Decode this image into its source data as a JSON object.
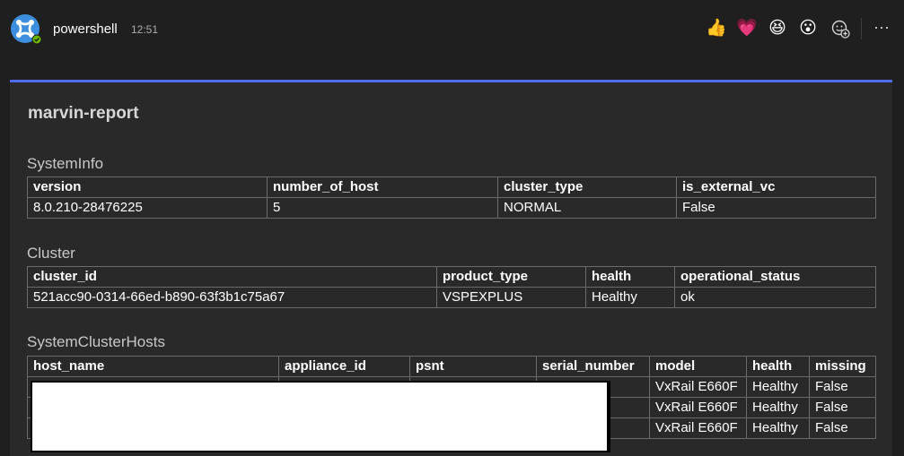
{
  "header": {
    "sender": "powershell",
    "time": "12:51",
    "more_label": "···",
    "reactions": [
      {
        "icon": "thumbs-up-icon",
        "glyph": "👍"
      },
      {
        "icon": "heart-icon",
        "glyph": "💗"
      },
      {
        "icon": "laugh-icon",
        "glyph": "😆"
      },
      {
        "icon": "surprised-icon",
        "glyph": "😮"
      }
    ]
  },
  "card": {
    "title": "marvin-report",
    "system_info": {
      "label": "SystemInfo",
      "headers": [
        "version",
        "number_of_host",
        "cluster_type",
        "is_external_vc"
      ],
      "rows": [
        [
          "8.0.210-28476225",
          "5",
          "NORMAL",
          "False"
        ]
      ]
    },
    "cluster": {
      "label": "Cluster",
      "headers": [
        "cluster_id",
        "product_type",
        "health",
        "operational_status"
      ],
      "rows": [
        [
          "521acc90-0314-66ed-b890-63f3b1c75a67",
          "VSPEXPLUS",
          "Healthy",
          "ok"
        ]
      ]
    },
    "hosts": {
      "label": "SystemClusterHosts",
      "headers": [
        "host_name",
        "appliance_id",
        "psnt",
        "serial_number",
        "model",
        "health",
        "missing"
      ],
      "rows": [
        [
          "",
          "",
          "",
          "",
          "VxRail E660F",
          "Healthy",
          "False"
        ],
        [
          "",
          "",
          "",
          "",
          "VxRail E660F",
          "Healthy",
          "False"
        ],
        [
          "",
          "",
          "",
          "",
          "VxRail E660F",
          "Healthy",
          "False"
        ]
      ]
    }
  },
  "colors": {
    "background": "#1f1f1f",
    "card": "#292929",
    "accent": "#4f6bed",
    "border": "#6b6b6b"
  }
}
